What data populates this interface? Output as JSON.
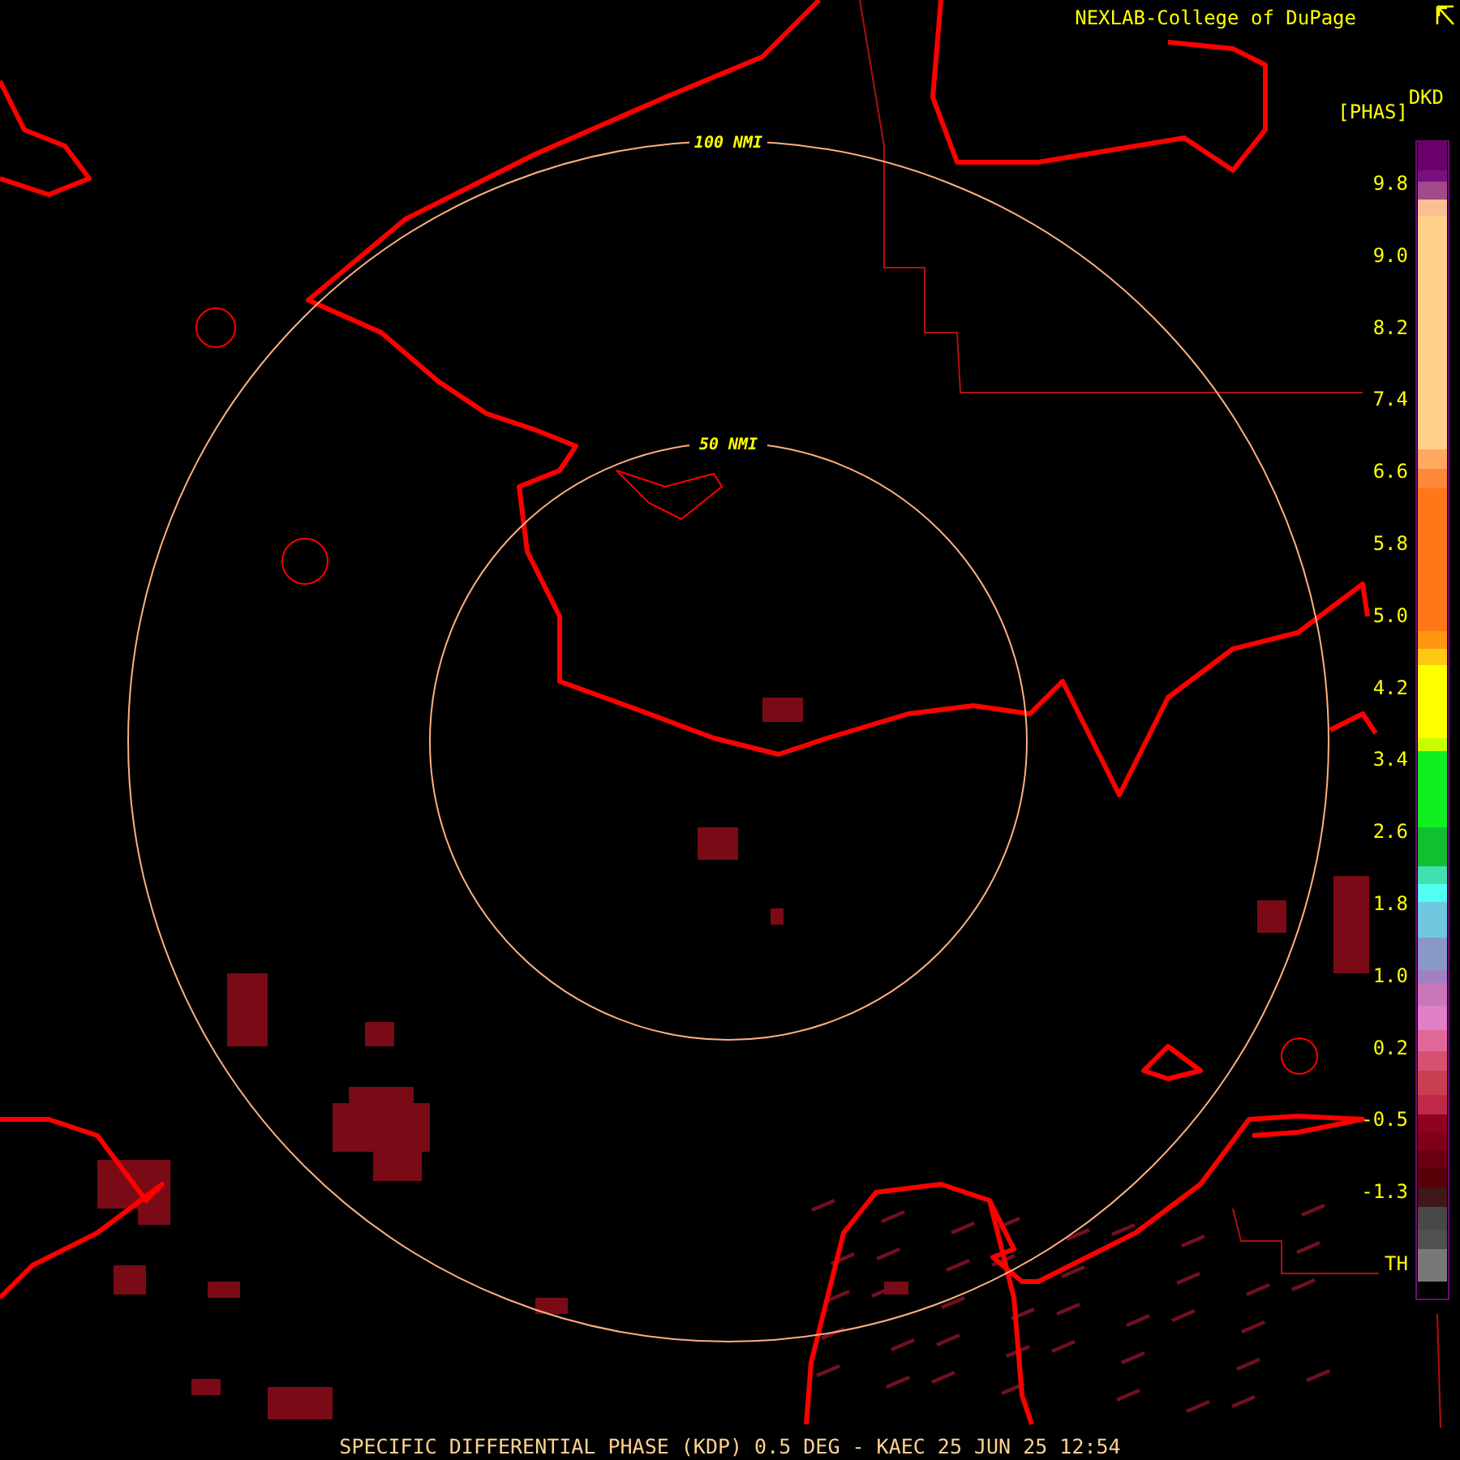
{
  "credit": {
    "text": "NEXLAB-College of DuPage"
  },
  "legend": {
    "unit": "DKD",
    "product": "[PHAS]",
    "labels": [
      "9.8",
      "9.0",
      "8.2",
      "7.4",
      "6.6",
      "5.8",
      "5.0",
      "4.2",
      "3.4",
      "2.6",
      "1.8",
      "1.0",
      "0.2",
      "-0.5",
      "-1.3",
      "TH"
    ]
  },
  "range_rings": [
    {
      "label": "100 NMI"
    },
    {
      "label": "50 NMI"
    }
  ],
  "footer": {
    "title": "SPECIFIC DIFFERENTIAL PHASE (KDP) 0.5 DEG - KAEC 25 JUN 25 12:54"
  }
}
